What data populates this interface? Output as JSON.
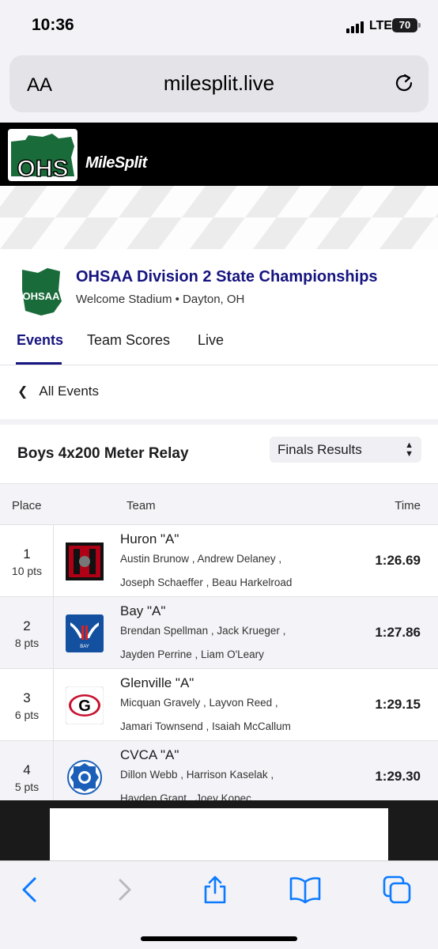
{
  "status_bar": {
    "time": "10:36",
    "network": "LTE",
    "battery": "70"
  },
  "browser": {
    "text_size_label": "AA",
    "url": "milesplit.live"
  },
  "site": {
    "logo_text": "OHS",
    "brand": "MileSplit"
  },
  "meet": {
    "logo_text": "OHSAA",
    "title": "OHSAA Division 2 State Championships",
    "location": "Welcome Stadium • Dayton, OH",
    "tabs": [
      {
        "label": "Events",
        "active": true
      },
      {
        "label": "Team Scores",
        "active": false
      },
      {
        "label": "Live",
        "active": false
      }
    ],
    "back_label": "All Events"
  },
  "event": {
    "title": "Boys 4x200 Meter Relay",
    "view_select": "Finals Results",
    "columns": {
      "place": "Place",
      "team": "Team",
      "time": "Time"
    },
    "results": [
      {
        "place": "1",
        "points": "10 pts",
        "team": "Huron \"A\"",
        "athletes_line1": "Austin Brunow ,  Andrew Delaney ,",
        "athletes_line2": "Joseph Schaeffer ,  Beau Harkelroad",
        "time": "1:26.69",
        "logo_text": "H"
      },
      {
        "place": "2",
        "points": "8 pts",
        "team": "Bay \"A\"",
        "athletes_line1": "Brendan Spellman ,  Jack Krueger ,",
        "athletes_line2": "Jayden Perrine ,  Liam O'Leary",
        "time": "1:27.86",
        "logo_text": "BAY"
      },
      {
        "place": "3",
        "points": "6 pts",
        "team": "Glenville \"A\"",
        "athletes_line1": "Micquan Gravely ,  Layvon Reed ,",
        "athletes_line2": "Jamari Townsend ,  Isaiah McCallum",
        "time": "1:29.15",
        "logo_text": "G"
      },
      {
        "place": "4",
        "points": "5 pts",
        "team": "CVCA \"A\"",
        "athletes_line1": "Dillon Webb ,  Harrison Kaselak ,",
        "athletes_line2": "Hayden Grant ,  Joey Kopec",
        "time": "1:29.30",
        "logo_text": ""
      }
    ]
  },
  "colors": {
    "brand_navy": "#16147f",
    "ohs_green": "#1a6b3a",
    "header_black": "#000000"
  }
}
